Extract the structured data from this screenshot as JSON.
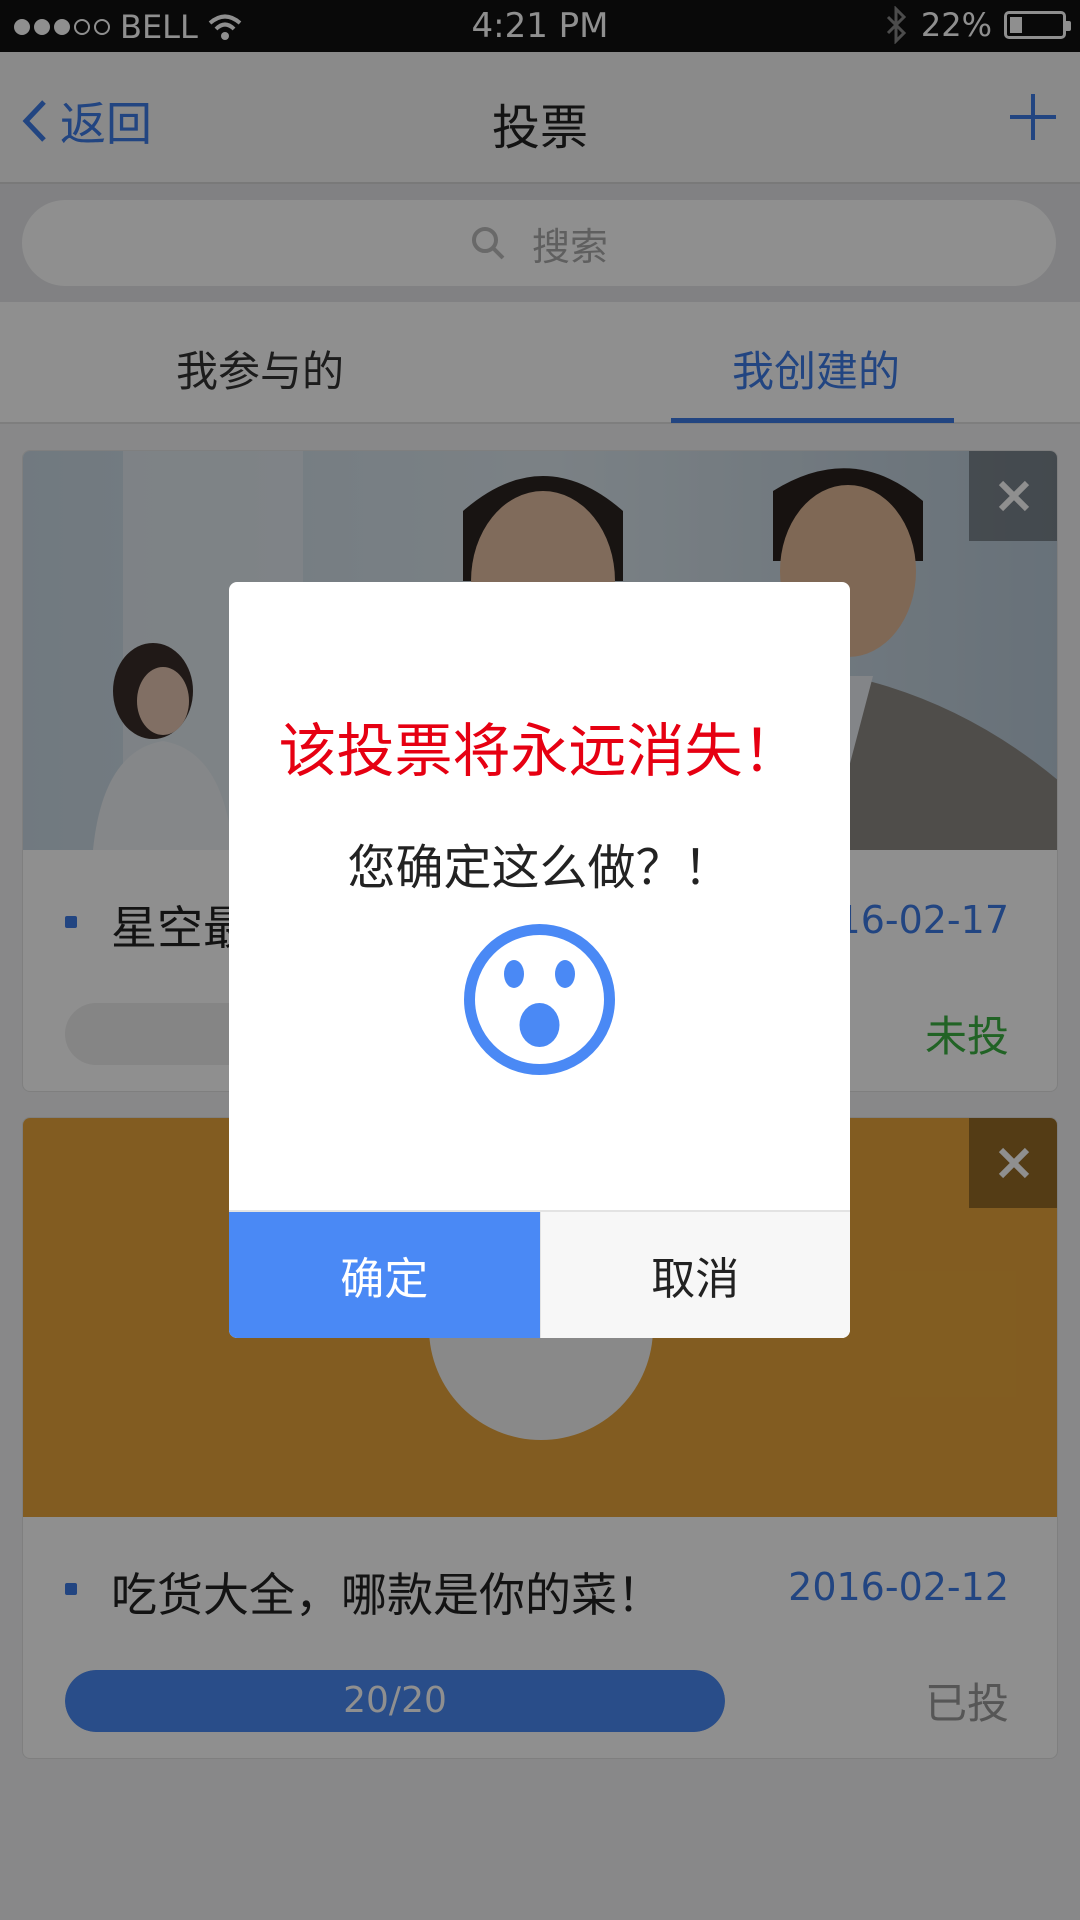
{
  "status_bar": {
    "carrier": "BELL",
    "time": "4:21 PM",
    "battery": "22%"
  },
  "nav": {
    "back_label": "返回",
    "title": "投票"
  },
  "search": {
    "placeholder": "搜索"
  },
  "tabs": [
    {
      "label": "我参与的"
    },
    {
      "label": "我创建的"
    }
  ],
  "cards": [
    {
      "title": "星空最",
      "date": "16-02-17",
      "status": "未投"
    },
    {
      "title": "吃货大全，哪款是你的菜！",
      "date": "2016-02-12",
      "progress": "20/20",
      "progress_fraction": 1.0,
      "status": "已投"
    }
  ],
  "dialog": {
    "warning": "该投票将永远消失！",
    "question": "您确定这么做？！",
    "confirm": "确定",
    "cancel": "取消"
  },
  "colors": {
    "accent": "#4a89f5",
    "warning": "#e60012",
    "not_voted": "#3cb043",
    "card2_bg": "#e8a53b"
  }
}
